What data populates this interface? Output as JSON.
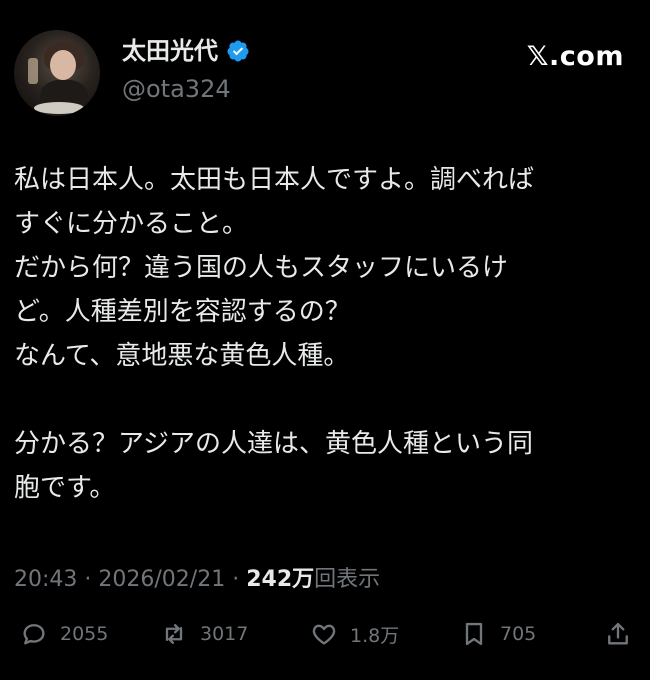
{
  "profile": {
    "display_name": "太田光代",
    "handle": "@ota324",
    "verified_color": "#1d9bf0"
  },
  "brand": {
    "label": "𝕏.com"
  },
  "tweet": {
    "paragraph1": [
      "私は日本人。太田も日本人ですよ。調べれば",
      "すぐに分かること。",
      "だから何？違う国の人もスタッフにいるけ",
      "ど。人種差別を容認するの？",
      "なんて、意地悪な黄色人種。"
    ],
    "paragraph2": [
      "分かる？アジアの人達は、黄色人種という同",
      "胞です。"
    ]
  },
  "meta": {
    "time": "20:43",
    "date": "2026/02/21",
    "separator": "·",
    "views_count": "242万",
    "views_label": "回表示"
  },
  "actions": {
    "replies": "2055",
    "retweets": "3017",
    "likes": "1.8万",
    "bookmarks": "705"
  },
  "icons": [
    "comment-icon",
    "retweet-icon",
    "like-icon",
    "bookmark-icon",
    "share-icon",
    "verified-badge-icon"
  ]
}
